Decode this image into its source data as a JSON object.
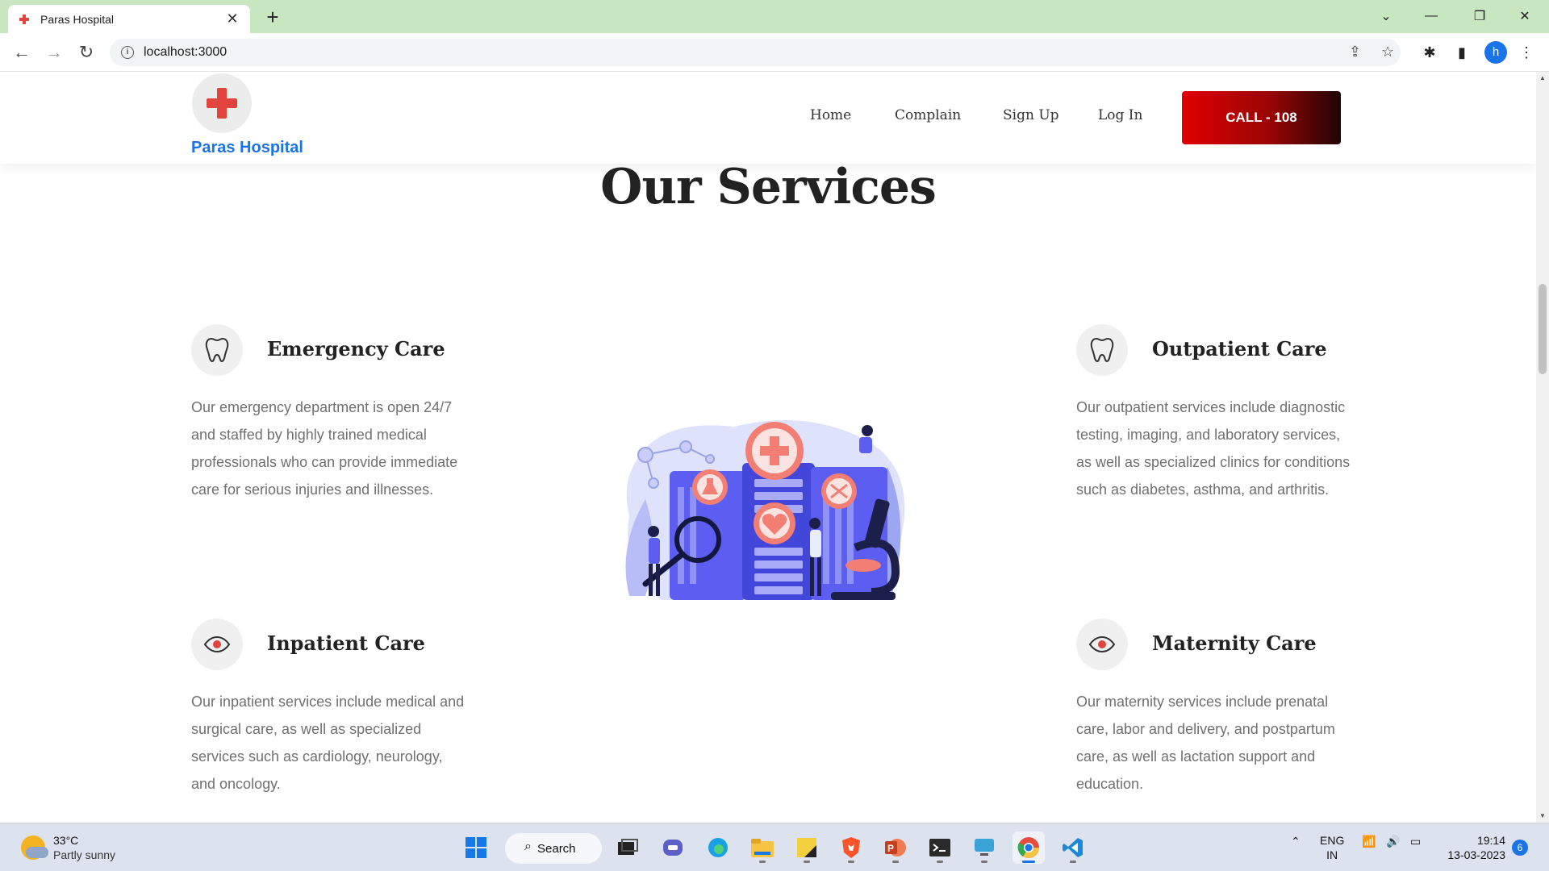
{
  "browser": {
    "tab_title": "Paras Hospital",
    "tab_close": "✕",
    "new_tab": "+",
    "url": "localhost:3000",
    "profile_initial": "h"
  },
  "site": {
    "brand": "Paras Hospital",
    "nav": [
      "Home",
      "Complain",
      "Sign Up",
      "Log In"
    ],
    "call_button": "CALL - 108",
    "section_title": "Our Services",
    "services": [
      {
        "icon": "tooth-icon",
        "title": "Emergency Care",
        "description": "Our emergency department is open 24/7 and staffed by highly trained medical professionals who can provide immediate care for serious injuries and illnesses."
      },
      {
        "icon": "tooth-icon",
        "title": "Outpatient Care",
        "description": "Our outpatient services include diagnostic testing, imaging, and laboratory services, as well as specialized clinics for conditions such as diabetes, asthma, and arthritis."
      },
      {
        "icon": "eye-icon",
        "title": "Inpatient Care",
        "description": "Our inpatient services include medical and surgical care, as well as specialized services such as cardiology, neurology, and oncology."
      },
      {
        "icon": "eye-icon",
        "title": "Maternity Care",
        "description": "Our maternity services include prenatal care, labor and delivery, and postpartum care, as well as lactation support and education."
      }
    ],
    "colors": {
      "accent_red": "#e0443c",
      "brand_blue": "#1a73e8",
      "illustration_blue": "#5b5ef0"
    }
  },
  "taskbar": {
    "weather_temp": "33°C",
    "weather_condition": "Partly sunny",
    "search_label": "Search",
    "language_line1": "ENG",
    "language_line2": "IN",
    "time": "19:14",
    "date": "13-03-2023",
    "notification_count": "6"
  }
}
